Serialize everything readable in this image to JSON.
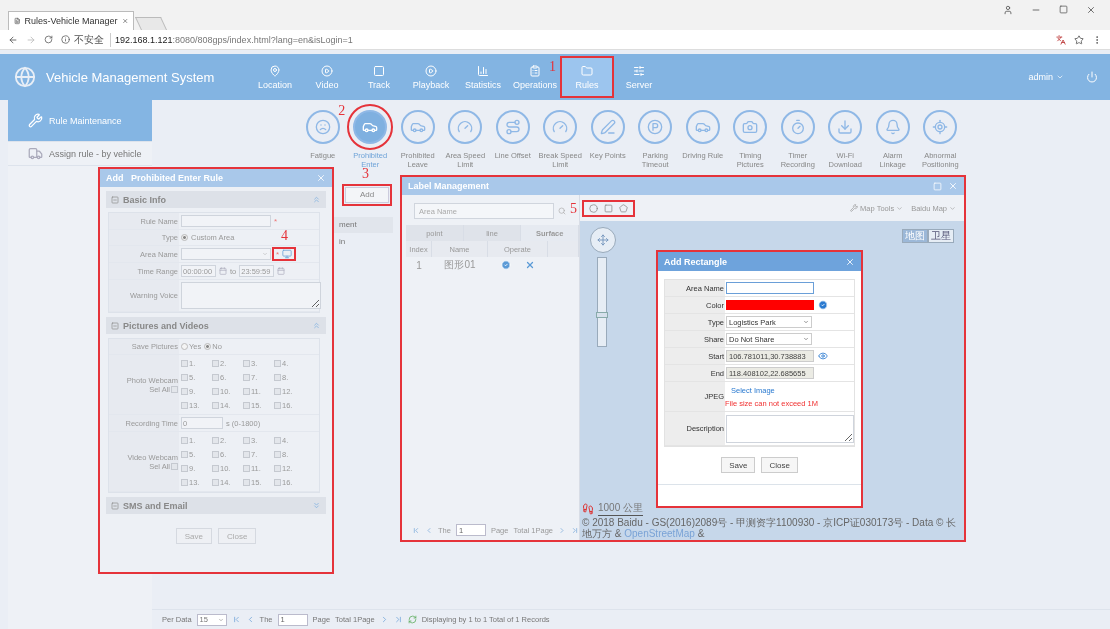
{
  "browser": {
    "tab_title": "Rules-Vehicle Manager",
    "insecure_label": "不安全",
    "url_host": "192.168.1.121",
    "url_path": ":8080/808gps/index.html?lang=en&isLogin=1"
  },
  "header": {
    "title": "Vehicle Management System",
    "user": "admin",
    "nav": [
      {
        "label": "Location",
        "selected": false
      },
      {
        "label": "Video",
        "selected": false
      },
      {
        "label": "Track",
        "selected": false
      },
      {
        "label": "Playback",
        "selected": false
      },
      {
        "label": "Statistics",
        "selected": false
      },
      {
        "label": "Operations",
        "selected": false
      },
      {
        "label": "Rules",
        "selected": true,
        "callout": "1"
      },
      {
        "label": "Server",
        "selected": false
      }
    ]
  },
  "sidebar": [
    {
      "label": "Rule Maintenance",
      "selected": true
    },
    {
      "label": "Assign rule - by vehicle",
      "selected": false
    }
  ],
  "rule_types": [
    {
      "label": "Fatigue",
      "selected": false
    },
    {
      "label": "Prohibited Enter",
      "selected": true,
      "callout": "2"
    },
    {
      "label": "Prohibited Leave",
      "selected": false
    },
    {
      "label": "Area Speed Limit",
      "selected": false
    },
    {
      "label": "Line Offset",
      "selected": false
    },
    {
      "label": "Break Speed Limit",
      "selected": false
    },
    {
      "label": "Key Points",
      "selected": false
    },
    {
      "label": "Parking Timeout",
      "selected": false
    },
    {
      "label": "Driving Rule",
      "selected": false
    },
    {
      "label": "Timing Pictures",
      "selected": false
    },
    {
      "label": "Timer Recording",
      "selected": false
    },
    {
      "label": "Wi-Fi Download",
      "selected": false
    },
    {
      "label": "Alarm Linkage",
      "selected": false
    },
    {
      "label": "Abnormal Positioning",
      "selected": false
    }
  ],
  "toolbar": {
    "add_button": "Add",
    "callout": "3"
  },
  "rule_table": {
    "column_1": "ment",
    "cell": "in"
  },
  "pager": {
    "per_data_label": "Per Data",
    "per_data": "15",
    "the": "The",
    "page": "1",
    "page_label": "Page",
    "total": "Total 1Page",
    "summary": "Displaying by 1 to 1 Total of 1 Records"
  },
  "rule_dialog": {
    "title": "Add   Prohibited Enter Rule",
    "highlighted": true,
    "sections": [
      {
        "title": "Basic Info",
        "expanded": true
      },
      {
        "title": "Pictures and Videos",
        "expanded": true
      },
      {
        "title": "SMS and Email",
        "expanded": false
      }
    ],
    "rule_name_label": "Rule Name",
    "rule_name_required": "*",
    "type_label": "Type",
    "type_option": {
      "label": "Custom Area",
      "selected": true
    },
    "area_name_label": "Area Name",
    "area_name_required": "*",
    "area_picker_callout": "4",
    "time_range_label": "Time Range",
    "time_from": "00:00:00",
    "to": "to",
    "time_to": "23:59:59",
    "warning_voice_label": "Warning Voice",
    "save_pictures_label": "Save Pictures",
    "save_pictures_options": [
      {
        "label": "Yes",
        "selected": false
      },
      {
        "label": "No",
        "selected": true
      }
    ],
    "photo_webcam_label": "Photo Webcam",
    "photo_sel_all": {
      "label": "Sel All",
      "checked": false
    },
    "photo_channels": [
      {
        "label": "1.",
        "checked": false
      },
      {
        "label": "2.",
        "checked": false
      },
      {
        "label": "3.",
        "checked": false
      },
      {
        "label": "4.",
        "checked": false
      },
      {
        "label": "5.",
        "checked": false
      },
      {
        "label": "6.",
        "checked": false
      },
      {
        "label": "7.",
        "checked": false
      },
      {
        "label": "8.",
        "checked": false
      },
      {
        "label": "9.",
        "checked": false
      },
      {
        "label": "10.",
        "checked": false
      },
      {
        "label": "11.",
        "checked": false
      },
      {
        "label": "12.",
        "checked": false
      },
      {
        "label": "13.",
        "checked": false
      },
      {
        "label": "14.",
        "checked": false
      },
      {
        "label": "15.",
        "checked": false
      },
      {
        "label": "16.",
        "checked": false
      }
    ],
    "recording_time_label": "Recording Time",
    "recording_time": "0",
    "recording_hint": "s (0-1800)",
    "video_webcam_label": "Video Webcam",
    "video_sel_all": {
      "label": "Sel All",
      "checked": false
    },
    "video_channels": [
      {
        "label": "1.",
        "checked": false
      },
      {
        "label": "2.",
        "checked": false
      },
      {
        "label": "3.",
        "checked": false
      },
      {
        "label": "4.",
        "checked": false
      },
      {
        "label": "5.",
        "checked": false
      },
      {
        "label": "6.",
        "checked": false
      },
      {
        "label": "7.",
        "checked": false
      },
      {
        "label": "8.",
        "checked": false
      },
      {
        "label": "9.",
        "checked": false
      },
      {
        "label": "10.",
        "checked": false
      },
      {
        "label": "11.",
        "checked": false
      },
      {
        "label": "12.",
        "checked": false
      },
      {
        "label": "13.",
        "checked": false
      },
      {
        "label": "14.",
        "checked": false
      },
      {
        "label": "15.",
        "checked": false
      },
      {
        "label": "16.",
        "checked": false
      }
    ],
    "buttons": [
      "Save",
      "Close"
    ]
  },
  "label_dialog": {
    "title": "Label Management",
    "highlighted": true,
    "search_placeholder": "Area Name",
    "tabs": [
      {
        "label": "point",
        "selected": false
      },
      {
        "label": "line",
        "selected": false
      },
      {
        "label": "Surface",
        "selected": true
      }
    ],
    "columns": [
      "Index",
      "Name",
      "Operate"
    ],
    "rows": [
      {
        "index": "1",
        "name": "图形01"
      }
    ],
    "pager": {
      "the": "The",
      "page": "1",
      "page_label": "Page",
      "total": "Total 1Page"
    },
    "zoom": {
      "level": 0.35
    },
    "draw_tools_callout": "5",
    "map_tools": "Map Tools",
    "map_source": "Baidu Map",
    "map_types": [
      {
        "label": "地图",
        "selected": true
      },
      {
        "label": "卫星",
        "selected": false
      }
    ],
    "scale": "1000 公里",
    "copyright": "© 2018 Baidu - GS(2016)2089号 - 甲测资字1100930 - 京ICP证030173号 - Data © 长地万方 &",
    "osm": "OpenStreetMap",
    "osm_after": "&"
  },
  "rect_dialog": {
    "title": "Add Rectangle",
    "highlighted": true,
    "fields": [
      {
        "kind": "input",
        "label": "Area Name"
      },
      {
        "kind": "color",
        "label": "Color",
        "color": "#ff0000"
      },
      {
        "kind": "select",
        "label": "Type",
        "value": "Logistics Park"
      },
      {
        "kind": "select",
        "label": "Share",
        "value": "Do Not Share"
      },
      {
        "kind": "coords",
        "label": "Start",
        "value": "106.781011,30.738883",
        "preview": true
      },
      {
        "kind": "coords",
        "label": "End",
        "value": "118.408102,22.685655",
        "preview": false
      },
      {
        "kind": "image",
        "label": "JPEG",
        "link": "Select Image",
        "error": "File size can not exceed 1M"
      },
      {
        "kind": "textarea",
        "label": "Description"
      }
    ],
    "buttons": [
      "Save",
      "Close"
    ]
  }
}
